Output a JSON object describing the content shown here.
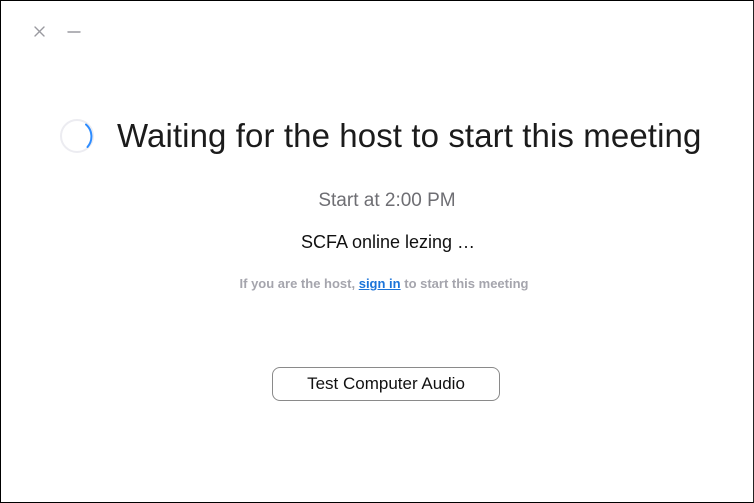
{
  "window": {
    "controls": {
      "close_icon": "close-icon",
      "minimize_icon": "minimize-icon"
    }
  },
  "main": {
    "heading": "Waiting for the host to start this meeting",
    "start_time": "Start at 2:00 PM",
    "meeting_name": "SCFA online lezing …",
    "host_prefix": "If you are the host,",
    "sign_in_link": "sign in",
    "host_suffix": "to start this meeting",
    "test_audio_button": "Test Computer Audio"
  },
  "colors": {
    "link": "#1a73d9",
    "muted": "#a5a5ad",
    "spinner_track": "#e8e8ee",
    "spinner_arc": "#2d8cff"
  }
}
